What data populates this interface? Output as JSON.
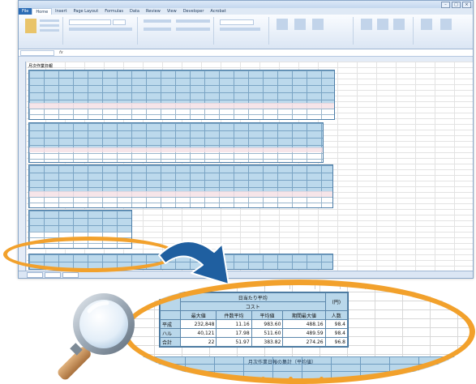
{
  "excel": {
    "menu_tabs": [
      "File",
      "Home",
      "Insert",
      "Page Layout",
      "Formulas",
      "Data",
      "Review",
      "View",
      "Developer",
      "Acrobat"
    ],
    "active_tab_index": 1,
    "sheet_title": "月次作業日報"
  },
  "zoom": {
    "header_lines": [
      "日当たり平均",
      "コスト",
      "(円)"
    ],
    "columns": [
      "最大値",
      "件数平均",
      "平均値",
      "期間最大値",
      "人数"
    ],
    "rows": [
      {
        "label": "平成",
        "values": [
          "232,848",
          "11.16",
          "983.60",
          "488.16",
          "98.4"
        ]
      },
      {
        "label": "ハル",
        "values": [
          "40,121",
          "17.98",
          "511.60",
          "489.59",
          "98.4"
        ]
      },
      {
        "label": "合計",
        "values": [
          "22",
          "51.97",
          "383.82",
          "274.26",
          "96.8"
        ]
      }
    ],
    "bottom_caption": "月次作業日報の集計（平均値）"
  },
  "colors": {
    "accent": "#f2a12c",
    "arrow": "#1f5fa0",
    "table_header": "#b9d7ea"
  }
}
